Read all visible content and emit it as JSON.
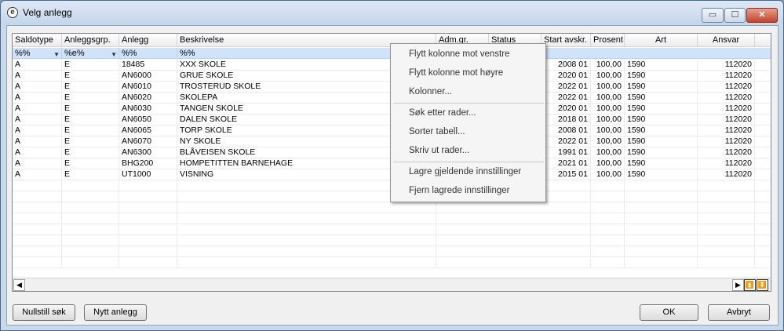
{
  "window": {
    "title": "Velg anlegg",
    "min": "▭",
    "max": "☐",
    "close": "✕"
  },
  "columns": [
    "Saldotype",
    "Anleggsgrp.",
    "Anlegg",
    "Beskrivelse",
    "Adm.gr.",
    "Status",
    "Start avskr.",
    "Prosent",
    "Art",
    "Ansvar"
  ],
  "filters": [
    "%%",
    "%e%",
    "%%",
    "%%"
  ],
  "rows": [
    [
      "A",
      "E",
      "18485",
      "XXX SKOLE",
      "2008 01",
      "100,00",
      "1590",
      "112020"
    ],
    [
      "A",
      "E",
      "AN6000",
      "GRUE SKOLE",
      "2020 01",
      "100,00",
      "1590",
      "112020"
    ],
    [
      "A",
      "E",
      "AN6010",
      "TROSTERUD SKOLE",
      "2022 01",
      "100,00",
      "1590",
      "112020"
    ],
    [
      "A",
      "E",
      "AN6020",
      "SKOLEPA",
      "2022 01",
      "100,00",
      "1590",
      "112020"
    ],
    [
      "A",
      "E",
      "AN6030",
      "TANGEN SKOLE",
      "2020 01",
      "100,00",
      "1590",
      "112020"
    ],
    [
      "A",
      "E",
      "AN6050",
      "DALEN SKOLE",
      "2018 01",
      "100,00",
      "1590",
      "112020"
    ],
    [
      "A",
      "E",
      "AN6065",
      "TORP SKOLE",
      "2008 01",
      "100,00",
      "1590",
      "112020"
    ],
    [
      "A",
      "E",
      "AN6070",
      "NY SKOLE",
      "2022 01",
      "100,00",
      "1590",
      "112020"
    ],
    [
      "A",
      "E",
      "AN6300",
      "BLÅVEISEN SKOLE",
      "1991 01",
      "100,00",
      "1590",
      "112020"
    ],
    [
      "A",
      "E",
      "BHG200",
      "HOMPETITTEN BARNEHAGE",
      "2021 01",
      "100,00",
      "1590",
      "112020"
    ],
    [
      "A",
      "E",
      "UT1000",
      "VISNING",
      "2015 01",
      "100,00",
      "1590",
      "112020"
    ]
  ],
  "context_menu": [
    "Flytt kolonne mot venstre",
    "Flytt kolonne mot høyre",
    "Kolonner...",
    "Søk etter rader...",
    "Sorter tabell...",
    "Skriv ut rader...",
    "Lagre gjeldende innstillinger",
    "Fjern lagrede innstillinger"
  ],
  "buttons": {
    "reset": "Nullstill søk",
    "new": "Nytt anlegg",
    "ok": "OK",
    "cancel": "Avbryt"
  },
  "icons": {
    "app": "velg-anlegg-app-icon",
    "dropdown": "chevron-down-icon"
  }
}
